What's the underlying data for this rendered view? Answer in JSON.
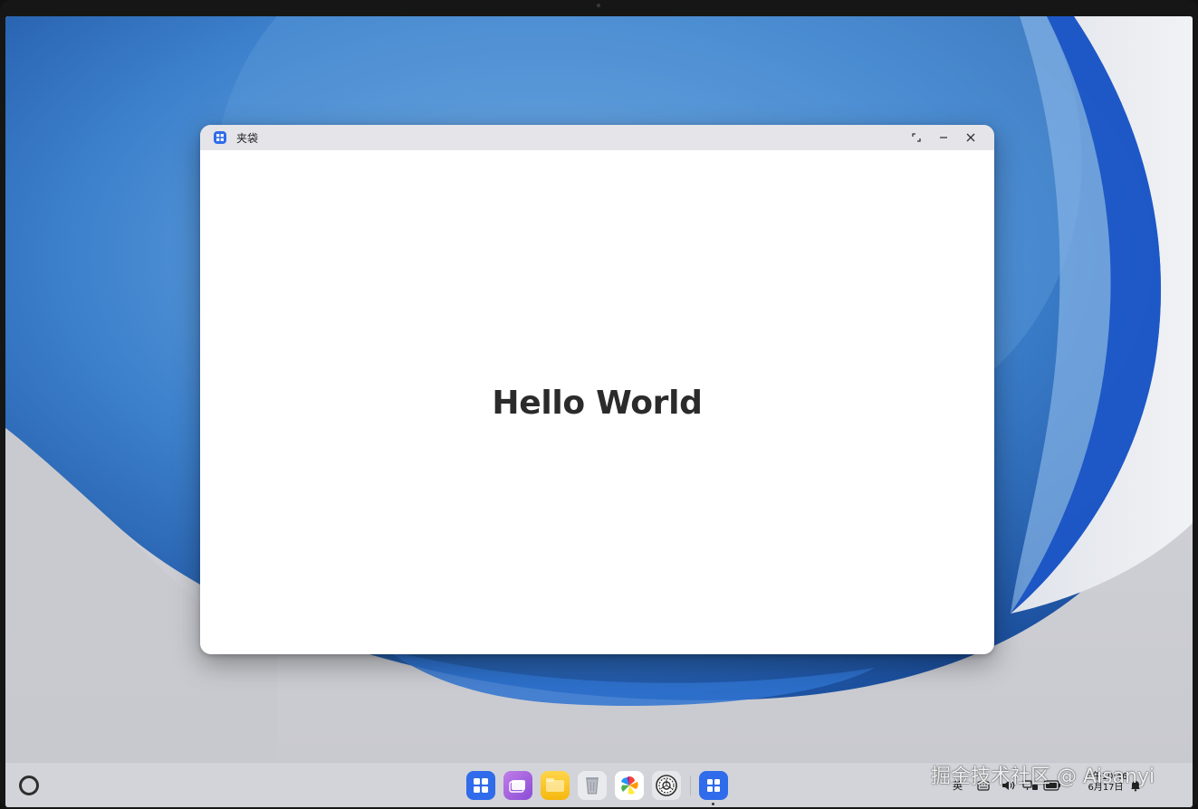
{
  "window": {
    "title": "夹袋",
    "content_text": "Hello World"
  },
  "taskbar": {
    "clock_line1": "上午10:46",
    "clock_line2": "6月17日",
    "ime_label": "英"
  },
  "watermark": "掘金技术社区 @ Aisanyi",
  "colors": {
    "accent": "#2f6bea",
    "titlebar": "#e4e4e9",
    "taskbar": "#d3d4da"
  },
  "dock_icons": [
    "app-center-icon",
    "multi-screen-icon",
    "files-icon",
    "trash-icon",
    "gallery-icon",
    "settings-icon",
    "running-app-icon"
  ]
}
